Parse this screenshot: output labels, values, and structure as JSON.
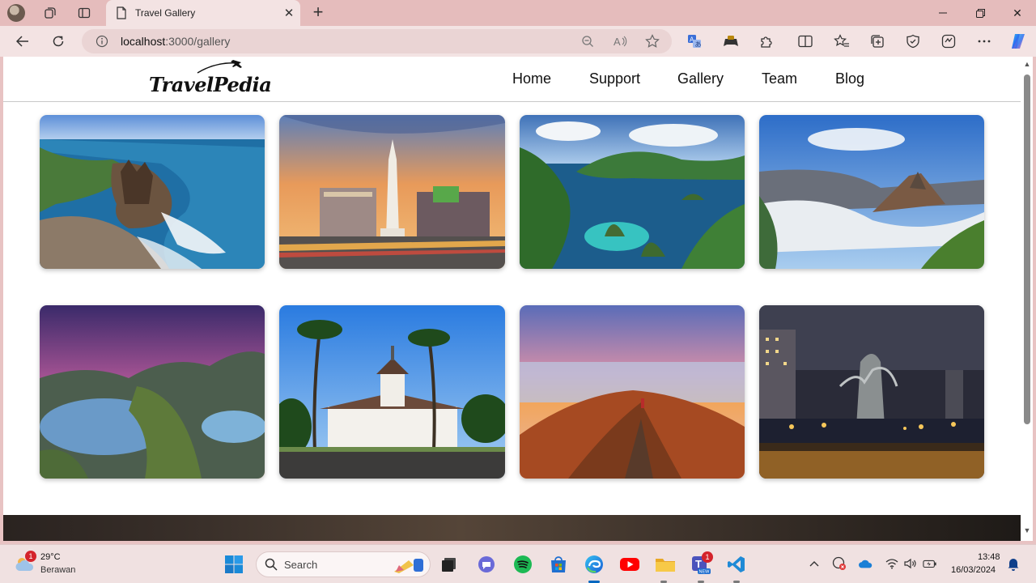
{
  "browser": {
    "tab_title": "Travel Gallery",
    "url_host": "localhost",
    "url_path": ":3000/gallery"
  },
  "site": {
    "logo_text": "TravelPedia",
    "nav": [
      "Home",
      "Support",
      "Gallery",
      "Team",
      "Blog"
    ]
  },
  "gallery": {
    "photos": [
      {
        "subject": "Tanah Lot temple on sea rock"
      },
      {
        "subject": "Tugu monument at sunset"
      },
      {
        "subject": "Tropical islands lagoon"
      },
      {
        "subject": "Volcano above sea of clouds"
      },
      {
        "subject": "Bays and hills at dusk"
      },
      {
        "subject": "Gedung Sate with palm trees"
      },
      {
        "subject": "Mountain peak sunrise"
      },
      {
        "subject": "Night city monument"
      }
    ]
  },
  "taskbar": {
    "weather_temp": "29°C",
    "weather_cond": "Berawan",
    "weather_badge": "1",
    "search_label": "Search",
    "teams_badge": "1",
    "time": "13:48",
    "date": "16/03/2024"
  },
  "colors": {
    "titlebar": "#e5bcbc",
    "toolbar": "#f3e3e3",
    "accent": "#0067c0"
  }
}
